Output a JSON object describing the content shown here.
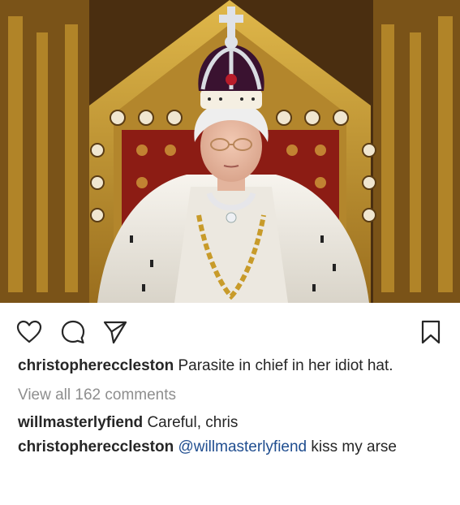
{
  "post": {
    "caption": {
      "username": "christophereccleston",
      "text": "Parasite in chief in her idiot hat."
    },
    "view_all_comments": "View all 162 comments",
    "comments": [
      {
        "username": "willmasterlyfiend",
        "mention": "",
        "text": "Careful, chris"
      },
      {
        "username": "christophereccleston",
        "mention": "@willmasterlyfiend",
        "text": "kiss my arse"
      }
    ]
  },
  "icons": {
    "like": "heart-outline-icon",
    "comment": "speech-bubble-icon",
    "share": "paper-plane-icon",
    "save": "bookmark-icon"
  },
  "colors": {
    "text": "#262626",
    "muted": "#8e8e8e",
    "mention": "#1f4d8f"
  }
}
